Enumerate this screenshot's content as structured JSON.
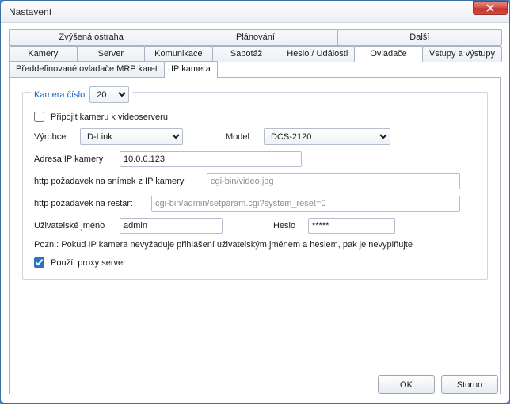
{
  "window": {
    "title": "Nastavení"
  },
  "tabs_row1": {
    "t0": "Zvýšená ostraha",
    "t1": "Plánování",
    "t2": "Další"
  },
  "tabs_row2": {
    "t0": "Kamery",
    "t1": "Server",
    "t2": "Komunikace",
    "t3": "Sabotáž",
    "t4": "Heslo / Události",
    "t5": "Ovladače",
    "t6": "Vstupy a výstupy"
  },
  "subtabs": {
    "t0": "Předdefinované ovladače MRP karet",
    "t1": "IP kamera"
  },
  "group": {
    "legend_prefix": "Kamera číslo",
    "camera_number": "20",
    "connect_label": "Připojit kameru k videoserveru",
    "connect_checked": false,
    "vendor_label": "Výrobce",
    "vendor_value": "D-Link",
    "model_label": "Model",
    "model_value": "DCS-2120",
    "ip_label": "Adresa IP kamery",
    "ip_value": "10.0.0.123",
    "snapshot_http_label": "http požadavek na snímek z IP kamery",
    "snapshot_http_value": "cgi-bin/video.jpg",
    "restart_http_label": "http požadavek na restart",
    "restart_http_value": "cgi-bin/admin/setparam.cgi?system_reset=0",
    "user_label": "Uživatelské jméno",
    "user_value": "admin",
    "pass_label": "Heslo",
    "pass_value": "*****",
    "note": "Pozn.: Pokud IP kamera nevyžaduje přihlášení uživatelským jménem a heslem, pak je nevyplňujte",
    "proxy_label": "Použít proxy server",
    "proxy_checked": true
  },
  "buttons": {
    "ok": "OK",
    "cancel": "Storno"
  }
}
